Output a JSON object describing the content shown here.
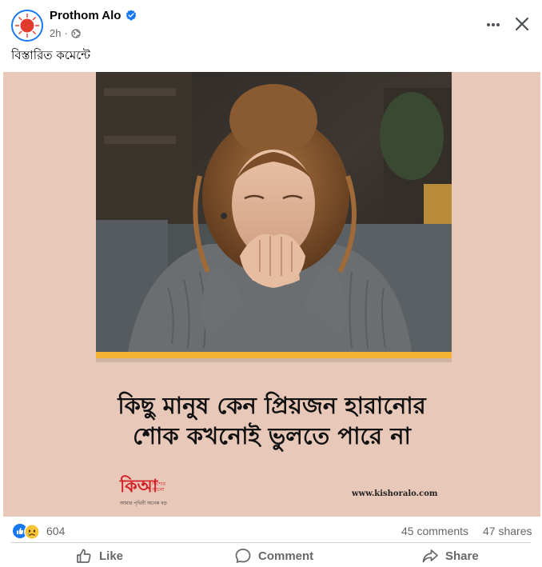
{
  "post": {
    "page_name": "Prothom Alo",
    "time": "2h",
    "separator": "·",
    "caption": "বিস্তারিত কমেন্টে",
    "image": {
      "headline_line1": "কিছু মানুষ কেন প্রিয়জন হারানোর",
      "headline_line2": "শোক কখনোই ভুলতে পারে না",
      "logo_main": "কিআ",
      "logo_side": "কিশোর আলো",
      "logo_tagline": "আমার পৃথিবী অনেক বড়",
      "site_url": "www.kishoralo.com"
    },
    "reactions": {
      "count": "604",
      "comments": "45 comments",
      "shares": "47 shares"
    },
    "actions": {
      "like": "Like",
      "comment": "Comment",
      "share": "Share"
    }
  },
  "colors": {
    "brand_blue": "#1877f2",
    "logo_red": "#e23b2e",
    "image_bg": "#e8c9b9",
    "accent_strip": "#f5b334",
    "secondary_text": "#65676b"
  },
  "icons": [
    "verified-icon",
    "globe-icon",
    "more-icon",
    "close-icon",
    "like-reaction-icon",
    "sad-reaction-icon",
    "thumbs-up-icon",
    "comment-icon",
    "share-icon"
  ]
}
